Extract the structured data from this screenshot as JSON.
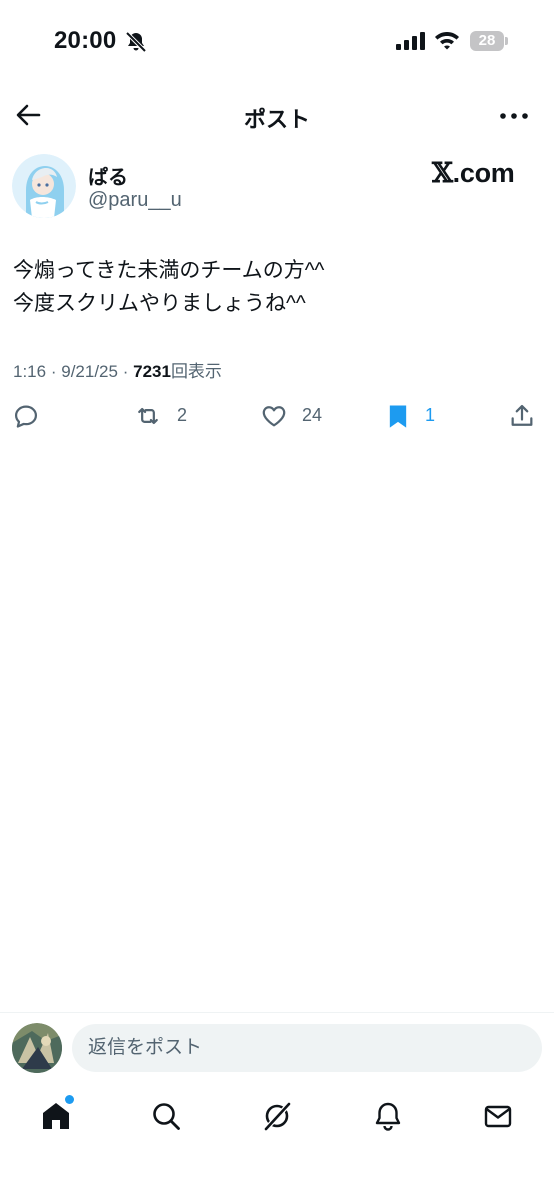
{
  "status_bar": {
    "time": "20:00",
    "battery_level": "28",
    "icons": [
      "bell-off-icon",
      "cellular-signal-icon",
      "wifi-icon",
      "battery-icon"
    ]
  },
  "header": {
    "title": "ポスト",
    "icons": [
      "back-arrow-icon",
      "more-icon"
    ]
  },
  "author": {
    "display_name": "ぱる",
    "handle": "@paru__u"
  },
  "watermark": {
    "x_letter": "𝕏",
    "domain": ".com"
  },
  "post": {
    "lines": [
      "今煽ってきた未満のチームの方^^",
      "今度スクリムやりましょうね^^"
    ],
    "time": "1:16",
    "separator_1": "·",
    "date": "9/21/25",
    "separator_2": "·",
    "views_count": "7231",
    "views_label": "回表示"
  },
  "actions": {
    "reply_icon": "reply-icon",
    "retweet_icon": "retweet-icon",
    "retweet_count": "2",
    "like_icon": "heart-icon",
    "like_count": "24",
    "bookmark_icon": "bookmark-icon",
    "bookmark_count": "1",
    "share_icon": "share-icon"
  },
  "reply_bar": {
    "placeholder": "返信をポスト"
  },
  "tab_bar": {
    "items": [
      "home-icon",
      "search-icon",
      "grok-icon",
      "notifications-icon",
      "messages-icon"
    ]
  },
  "colors": {
    "text": "#0f1419",
    "secondary": "#536471",
    "accent": "#1d9bf0",
    "input_bg": "#eff3f4"
  }
}
